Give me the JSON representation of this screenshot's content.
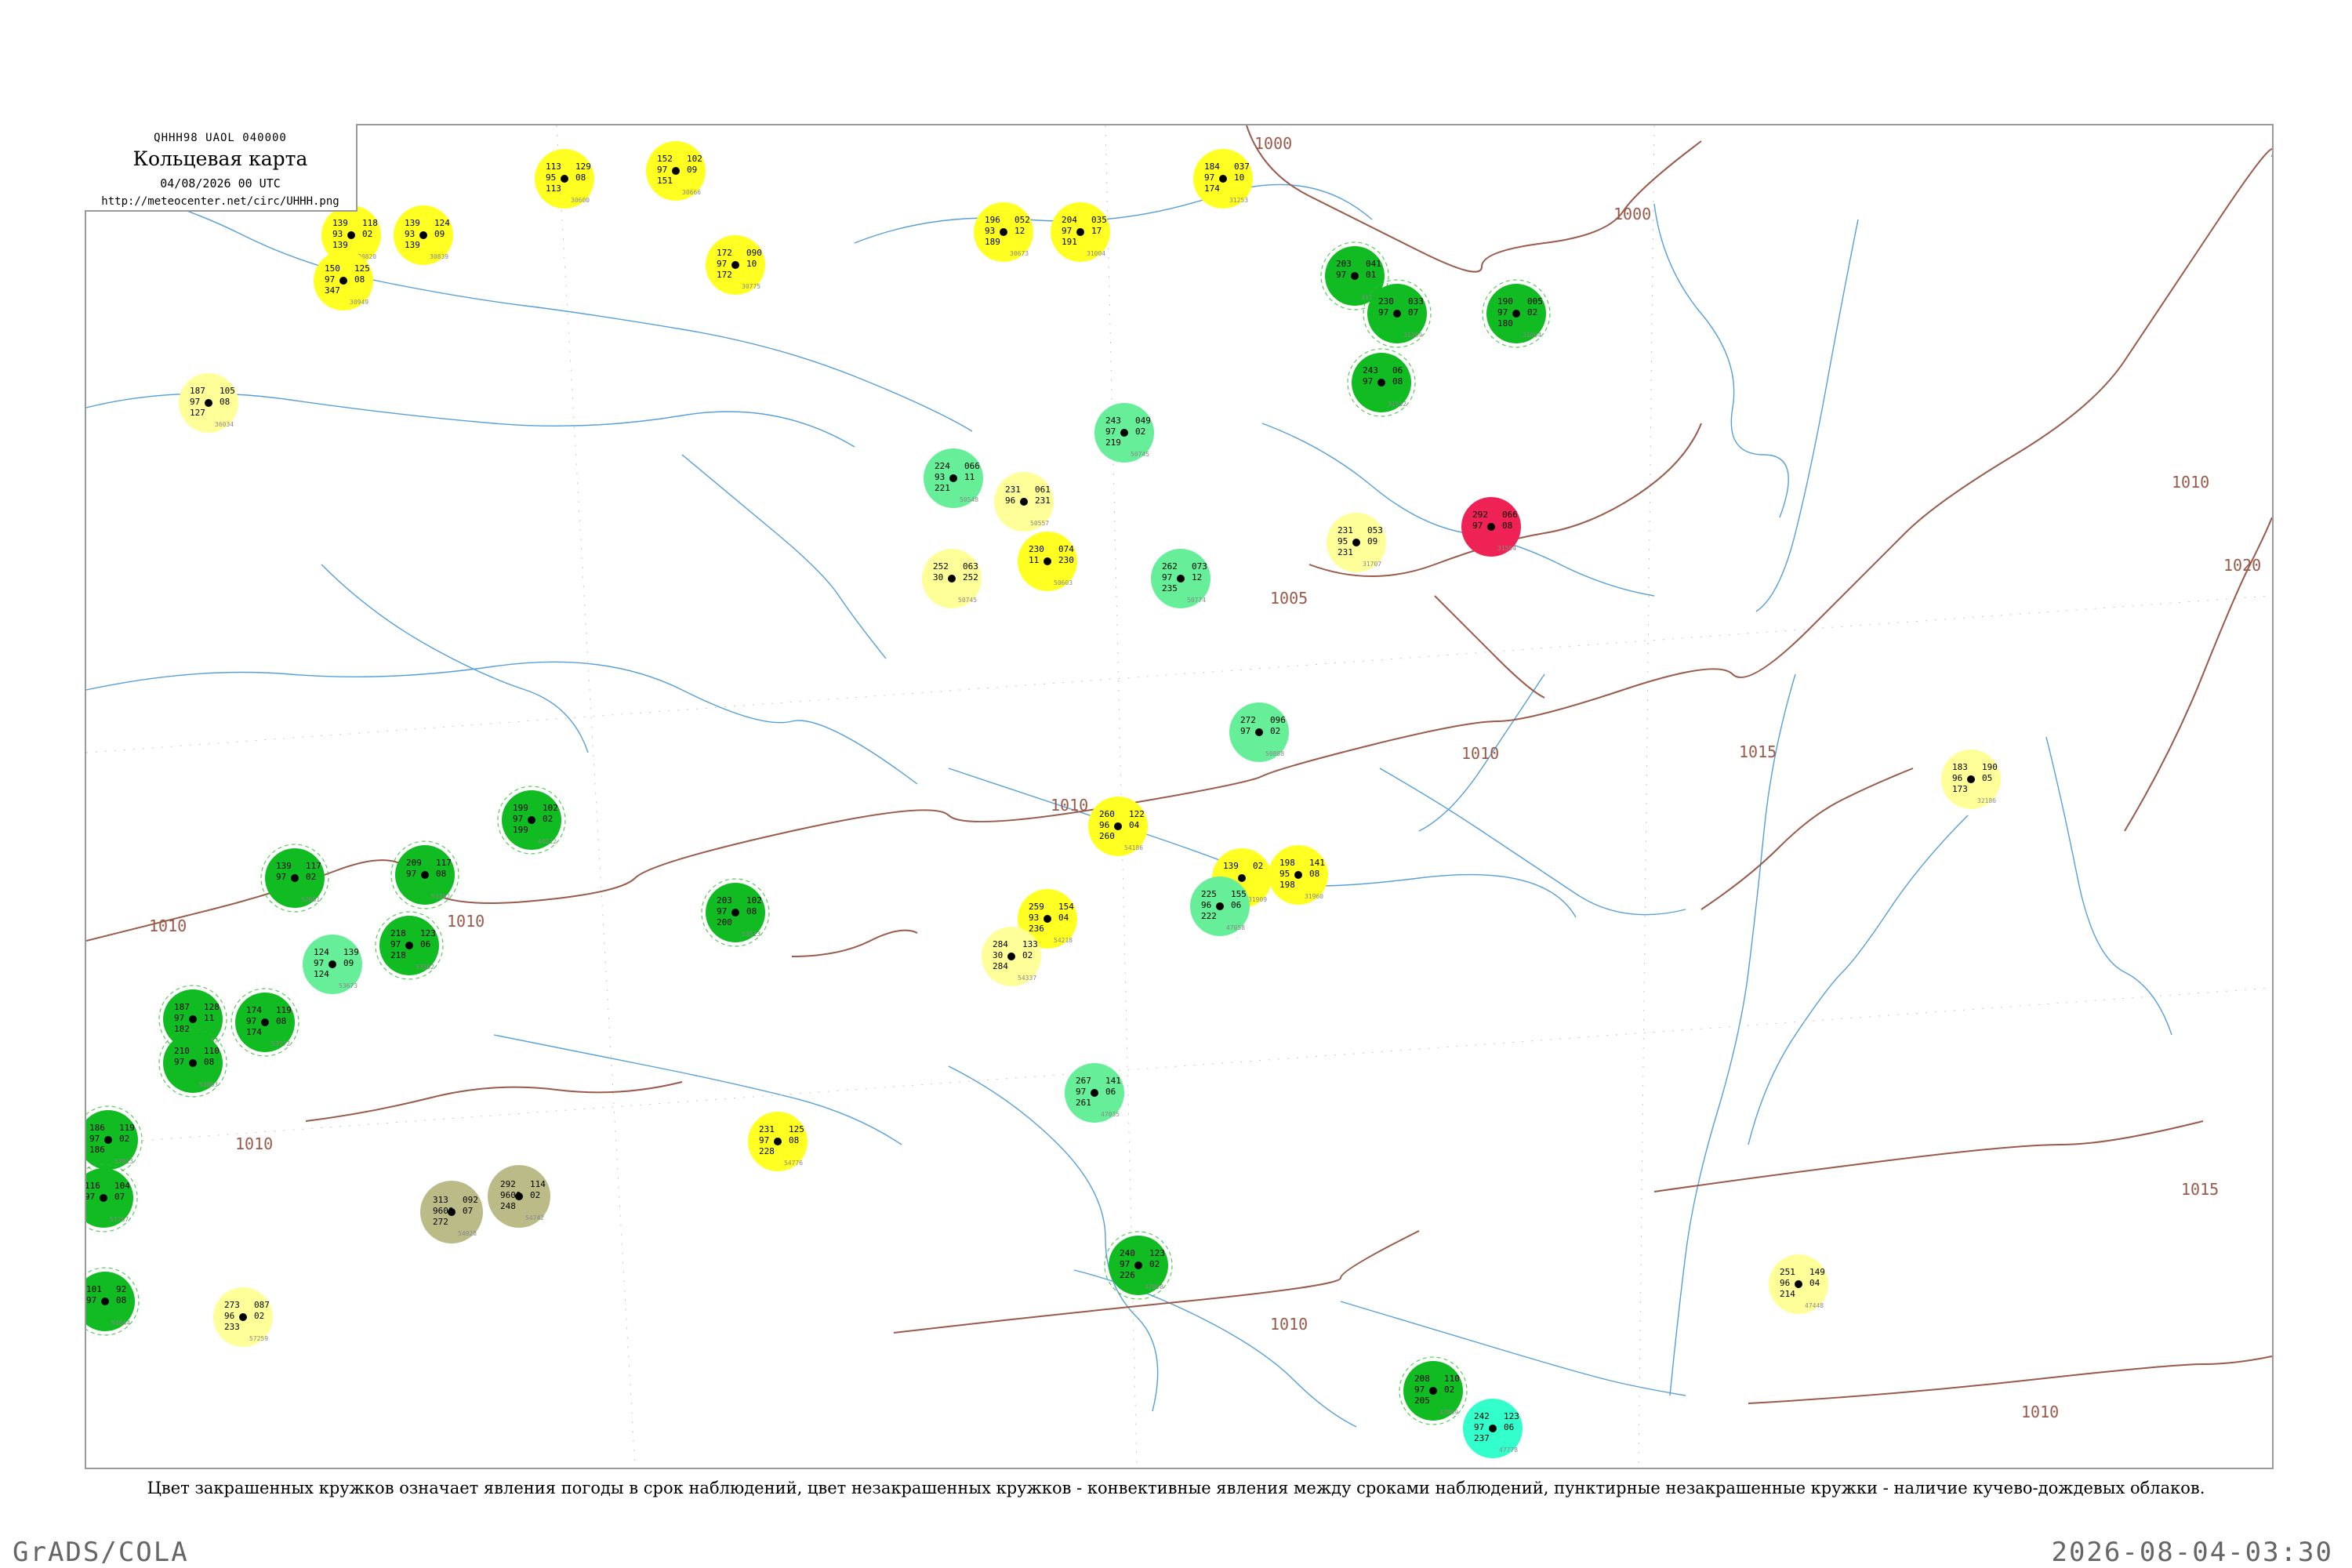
{
  "header": {
    "bulletin": "QHHH98  UAOL  040000",
    "title": "Кольцевая карта",
    "datetime": "04/08/2026 00 UTC",
    "url": "http://meteocenter.net/circ/UHHH.png"
  },
  "caption": "Цвет закрашенных кружков означает явления погоды в срок наблюдений, цвет незакрашенных кружков - конвективные явления между сроками наблюдений, пунктирные незакрашенные кружки - наличие кучево-дождевых облаков.",
  "footer": {
    "software": "GrADS/COLA",
    "generated": "2026-08-04-03:30"
  },
  "colors": {
    "background": "#ffffff",
    "frame": "#9a9a9a",
    "isobar": "#9a5a4a",
    "water": "#3a8fd0",
    "yellow": "#ffff22",
    "light_yellow": "#ffff99",
    "green": "#11bb22",
    "light_green": "#66ee99",
    "red": "#ee2255",
    "olive": "#bbbb88",
    "cyan": "#33ffcc",
    "dashed_ring": "#33bb33"
  },
  "isobars": [
    {
      "label": "1000"
    },
    {
      "label": "1005"
    },
    {
      "label": "1010"
    },
    {
      "label": "1015"
    },
    {
      "label": "1020"
    }
  ],
  "stations": [
    {
      "id": "s1",
      "color": "yellow",
      "nums": [
        "113",
        "129",
        "95",
        "08",
        "113"
      ],
      "wmo": "30600"
    },
    {
      "id": "s2",
      "color": "yellow",
      "nums": [
        "152",
        "102",
        "97",
        "09",
        "151"
      ],
      "wmo": "30666"
    },
    {
      "id": "s3",
      "color": "yellow",
      "nums": [
        "139",
        "118",
        "93",
        "02",
        "139"
      ],
      "wmo": "30820"
    },
    {
      "id": "s4",
      "color": "yellow",
      "nums": [
        "139",
        "124",
        "93",
        "09",
        "139"
      ],
      "wmo": "30839"
    },
    {
      "id": "s5",
      "color": "yellow",
      "nums": [
        "150",
        "125",
        "97",
        "08",
        "347"
      ],
      "wmo": "30949"
    },
    {
      "id": "s6",
      "color": "yellow",
      "nums": [
        "172",
        "090",
        "97",
        "10",
        "172"
      ],
      "wmo": "30775"
    },
    {
      "id": "s7",
      "color": "yellow",
      "nums": [
        "196",
        "052",
        "93",
        "12",
        "189"
      ],
      "wmo": "30673"
    },
    {
      "id": "s8",
      "color": "yellow",
      "nums": [
        "204",
        "035",
        "97",
        "17",
        "191"
      ],
      "wmo": "31004"
    },
    {
      "id": "s9",
      "color": "yellow",
      "nums": [
        "184",
        "037",
        "97",
        "10",
        "174"
      ],
      "wmo": "31253"
    },
    {
      "id": "s10",
      "color": "light_yellow",
      "nums": [
        "187",
        "105",
        "97",
        "08",
        "127"
      ],
      "wmo": "36034"
    },
    {
      "id": "s11",
      "color": "light_yellow",
      "nums": [
        "231",
        "061",
        "96",
        "231"
      ],
      "wmo": "50557"
    },
    {
      "id": "s12",
      "color": "yellow",
      "nums": [
        "230",
        "074",
        "11",
        "230"
      ],
      "wmo": "50603"
    },
    {
      "id": "s13",
      "color": "light_yellow",
      "nums": [
        "252",
        "063",
        "30",
        "252"
      ],
      "wmo": "50745"
    },
    {
      "id": "s14",
      "color": "light_yellow",
      "nums": [
        "231",
        "053",
        "95",
        "09",
        "231"
      ],
      "wmo": "31707"
    },
    {
      "id": "s15",
      "color": "red",
      "nums": [
        "292",
        "066",
        "97",
        "08"
      ],
      "wmo": "31594"
    },
    {
      "id": "s16",
      "color": "light_green",
      "nums": [
        "224",
        "066",
        "93",
        "11",
        "221"
      ],
      "wmo": "50548"
    },
    {
      "id": "s17",
      "color": "light_green",
      "nums": [
        "243",
        "049",
        "97",
        "02",
        "219"
      ],
      "wmo": "50745"
    },
    {
      "id": "s18",
      "color": "light_green",
      "nums": [
        "262",
        "073",
        "97",
        "12",
        "235"
      ],
      "wmo": "50774"
    },
    {
      "id": "s19",
      "color": "light_green",
      "nums": [
        "272",
        "096",
        "97",
        "02"
      ],
      "wmo": "50888"
    },
    {
      "id": "s20",
      "color": "yellow",
      "nums": [
        "260",
        "122",
        "96",
        "04",
        "260"
      ],
      "wmo": "54186"
    },
    {
      "id": "s21",
      "color": "yellow",
      "nums": [
        "198",
        "141",
        "95",
        "08",
        "198"
      ],
      "wmo": "31960"
    },
    {
      "id": "s22",
      "color": "yellow",
      "nums": [
        "139",
        "02"
      ],
      "wmo": "31909"
    },
    {
      "id": "s23",
      "color": "light_green",
      "nums": [
        "225",
        "155",
        "96",
        "06",
        "222"
      ],
      "wmo": "47058"
    },
    {
      "id": "s24",
      "color": "yellow",
      "nums": [
        "259",
        "154",
        "93",
        "04",
        "236"
      ],
      "wmo": "54218"
    },
    {
      "id": "s25",
      "color": "light_yellow",
      "nums": [
        "284",
        "133",
        "30",
        "02",
        "284"
      ],
      "wmo": "54337"
    },
    {
      "id": "s26",
      "color": "light_yellow",
      "nums": [
        "183",
        "190",
        "96",
        "05",
        "173"
      ],
      "wmo": "32186"
    },
    {
      "id": "s27",
      "color": "light_green",
      "nums": [
        "267",
        "141",
        "97",
        "06",
        "261"
      ],
      "wmo": "47035"
    },
    {
      "id": "s28",
      "color": "green",
      "nums": [
        "240",
        "123",
        "97",
        "02",
        "226"
      ],
      "wmo": "47098"
    },
    {
      "id": "s29",
      "color": "yellow",
      "nums": [
        "231",
        "125",
        "97",
        "08",
        "228"
      ],
      "wmo": "54776"
    },
    {
      "id": "s30",
      "color": "light_yellow",
      "nums": [
        "251",
        "149",
        "96",
        "04",
        "214"
      ],
      "wmo": "47448"
    },
    {
      "id": "s31",
      "color": "green",
      "nums": [
        "208",
        "110",
        "97",
        "02",
        "205"
      ],
      "wmo": "47869"
    },
    {
      "id": "s32",
      "color": "cyan",
      "nums": [
        "242",
        "123",
        "97",
        "06",
        "237"
      ],
      "wmo": "47778"
    },
    {
      "id": "s33",
      "color": "light_yellow",
      "nums": [
        "273",
        "087",
        "96",
        "02",
        "233"
      ],
      "wmo": "57259"
    },
    {
      "id": "s34",
      "color": "olive",
      "nums": [
        "313",
        "092",
        "9600",
        "07",
        "272"
      ],
      "wmo": "54928"
    },
    {
      "id": "s35",
      "color": "olive",
      "nums": [
        "292",
        "114",
        "9600",
        "02",
        "248"
      ],
      "wmo": "54742"
    },
    {
      "id": "s36",
      "color": "green",
      "nums": [
        "199",
        "102",
        "97",
        "02",
        "199"
      ],
      "wmo": "44212"
    },
    {
      "id": "s37",
      "color": "green",
      "nums": [
        "203",
        "102",
        "97",
        "08",
        "200"
      ],
      "wmo": "53513"
    },
    {
      "id": "s38",
      "color": "green",
      "nums": [
        "209",
        "117",
        "97",
        "08"
      ],
      "wmo": "53192"
    },
    {
      "id": "s39",
      "color": "green",
      "nums": [
        "218",
        "123",
        "97",
        "06",
        "218"
      ],
      "wmo": "53502"
    },
    {
      "id": "s40",
      "color": "green",
      "nums": [
        "187",
        "128",
        "97",
        "11",
        "182"
      ],
      "wmo": "53287"
    },
    {
      "id": "s41",
      "color": "green",
      "nums": [
        "174",
        "119",
        "97",
        "08",
        "174"
      ],
      "wmo": "53772"
    },
    {
      "id": "s42",
      "color": "green",
      "nums": [
        "210",
        "110",
        "97",
        "08"
      ],
      "wmo": "53863"
    },
    {
      "id": "s43",
      "color": "green",
      "nums": [
        "186",
        "119",
        "97",
        "02",
        "186"
      ],
      "wmo": "53913"
    },
    {
      "id": "s44",
      "color": "light_green",
      "nums": [
        "124",
        "139",
        "97",
        "09",
        "124"
      ],
      "wmo": "53673"
    },
    {
      "id": "s45",
      "color": "green",
      "nums": [
        "139",
        "117",
        "97",
        "02"
      ],
      "wmo": "52681"
    },
    {
      "id": "s46",
      "color": "green",
      "nums": [
        "116",
        "104",
        "97",
        "07"
      ],
      "wmo": "51767"
    },
    {
      "id": "s47",
      "color": "green",
      "nums": [
        "101",
        "92",
        "97",
        "08"
      ],
      "wmo": "51644"
    },
    {
      "id": "s48",
      "color": "green",
      "nums": [
        "203",
        "041",
        "97",
        "01"
      ],
      "wmo": "31168"
    },
    {
      "id": "s49",
      "color": "green",
      "nums": [
        "230",
        "033",
        "97",
        "07"
      ],
      "wmo": "31369"
    },
    {
      "id": "s50",
      "color": "green",
      "nums": [
        "190",
        "005",
        "97",
        "02",
        "180"
      ],
      "wmo": "31004"
    },
    {
      "id": "s51",
      "color": "green",
      "nums": [
        "243",
        "06",
        "97",
        "08"
      ],
      "wmo": "31532"
    }
  ]
}
